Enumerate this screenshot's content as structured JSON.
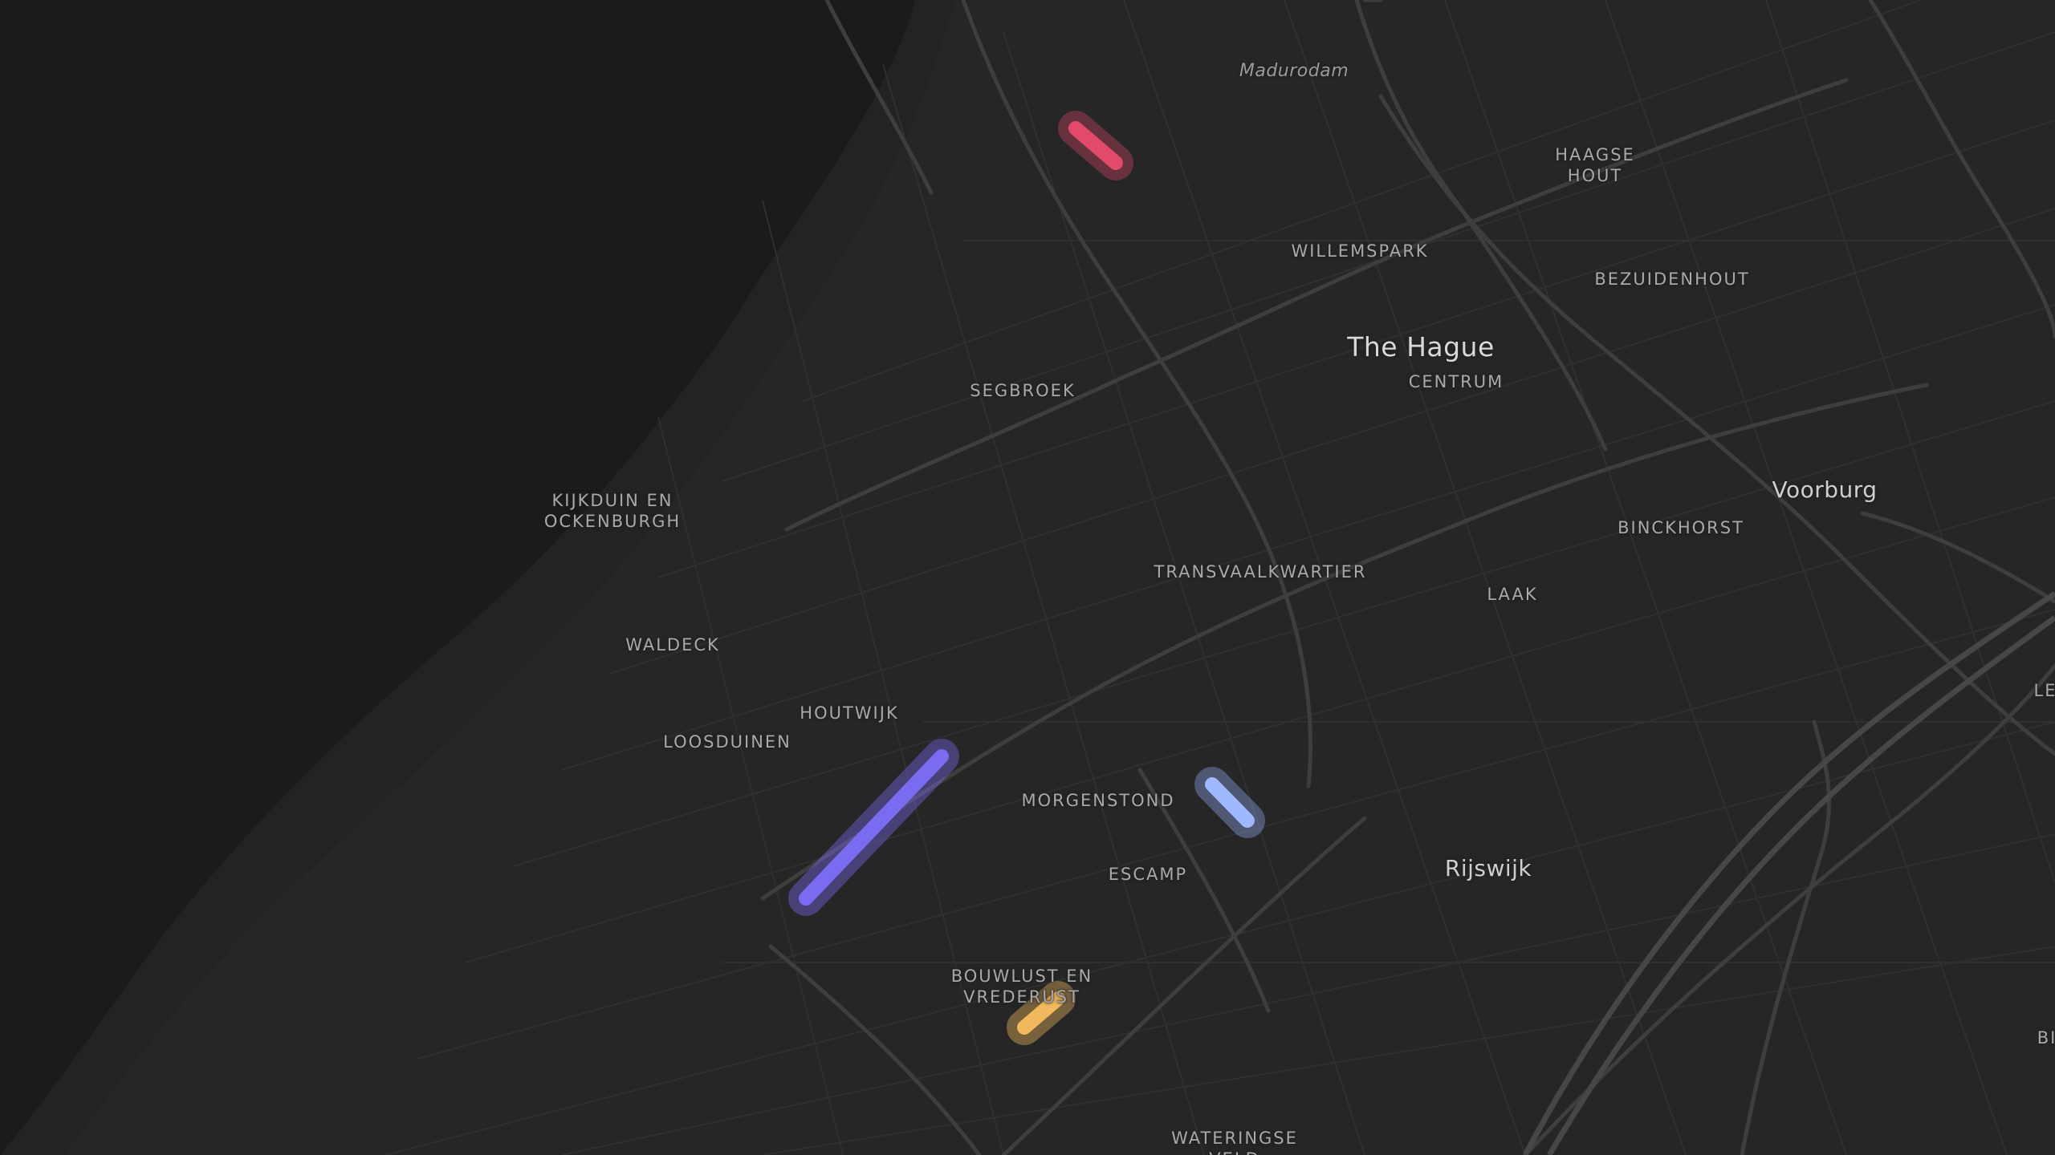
{
  "labels": {
    "madurodam": "Madurodam",
    "haagse_hout": "HAAGSE\nHOUT",
    "willemspark": "WILLEMSPARK",
    "bezuidenhout": "BEZUIDENHOUT",
    "the_hague": "The Hague",
    "centrum": "CENTRUM",
    "segbroek": "SEGBROEK",
    "kijkduin": "KIJKDUIN EN\nOCKENBURGH",
    "voorburg": "Voorburg",
    "binckhorst": "BINCKHORST",
    "transvaalkwartier": "TRANSVAALKWARTIER",
    "laak": "LAAK",
    "waldeck": "WALDECK",
    "houtwijk": "HOUTWIJK",
    "loosduinen": "LOOSDUINEN",
    "morgenstond": "MORGENSTOND",
    "escamp": "ESCAMP",
    "rijswijk": "Rijswijk",
    "bouwlust": "BOUWLUST EN\nVREDERUST",
    "wateringse": "WATERINGSE\nVELD",
    "edge_le": "LE",
    "edge_bi": "BI"
  },
  "colors": {
    "sea": "#1b1b1c",
    "land": "#262627",
    "road_major": "#3c3c3d",
    "road_minor": "#2f2f30",
    "route_red": "#e34a6a",
    "route_purple": "#7a6cf0",
    "route_blue": "#9fb8ff",
    "route_orange": "#f2b85c"
  },
  "routes": [
    {
      "id": "route-red",
      "color": "#e34a6a"
    },
    {
      "id": "route-purple",
      "color": "#7a6cf0"
    },
    {
      "id": "route-blue",
      "color": "#9fb8ff"
    },
    {
      "id": "route-orange",
      "color": "#f2b85c"
    }
  ]
}
